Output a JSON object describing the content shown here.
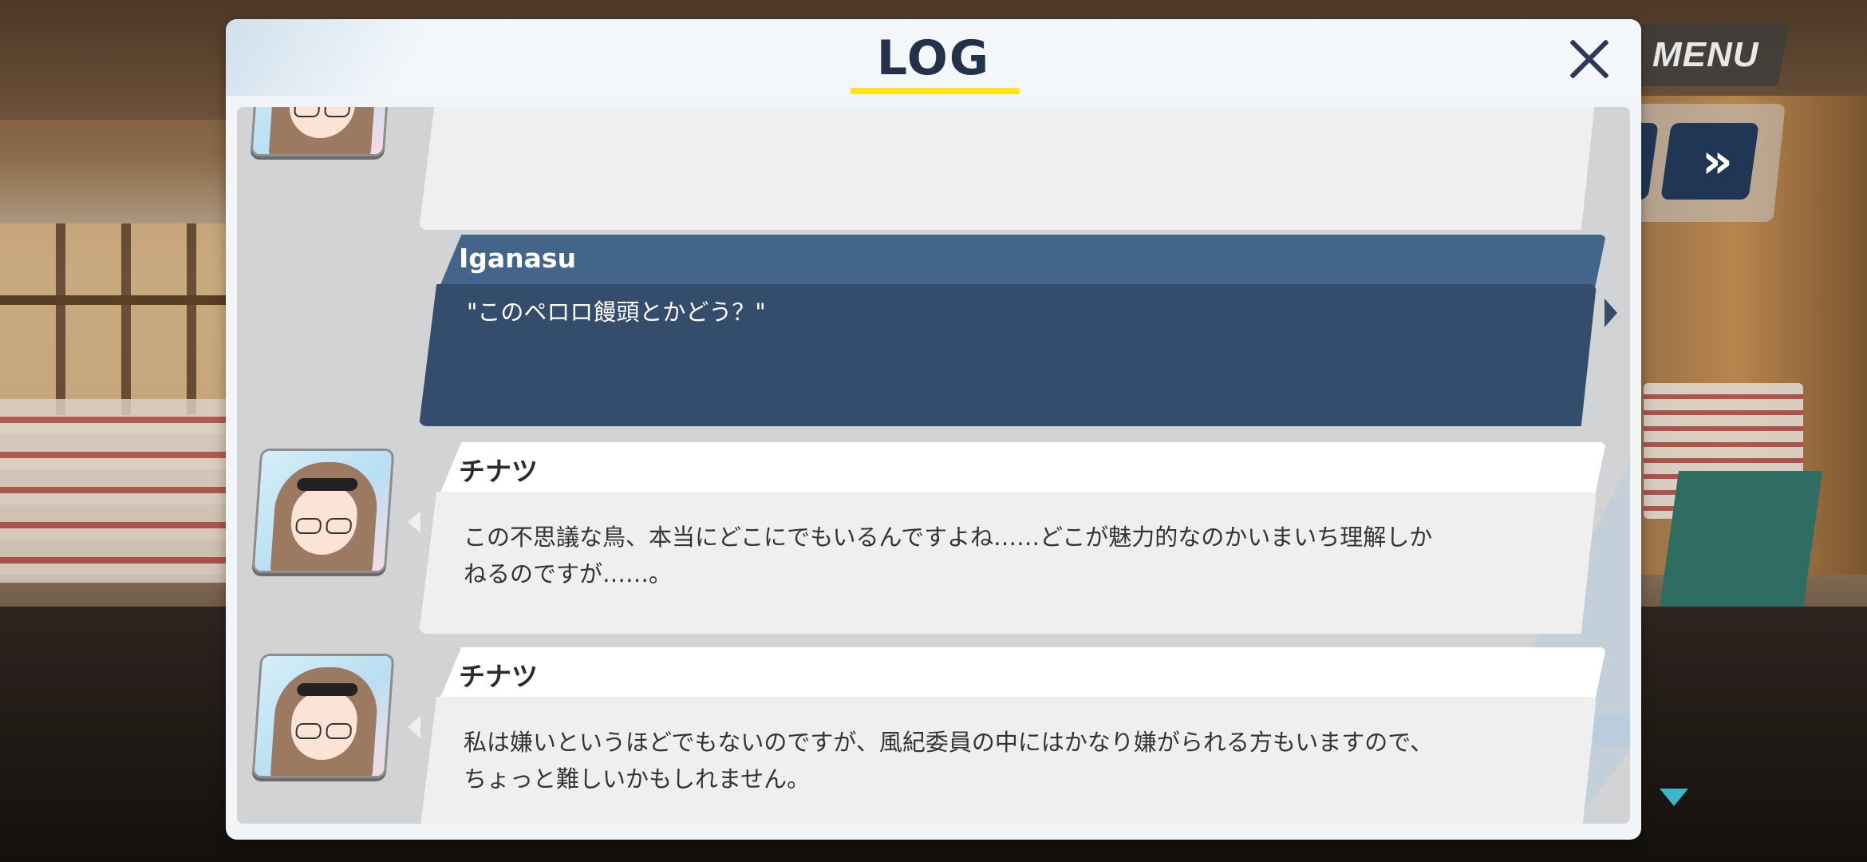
{
  "hud": {
    "menu_label": "MENU",
    "skip_glyph": "»"
  },
  "log": {
    "title": "LOG",
    "entries": [
      {
        "speaker": "",
        "text": "",
        "type": "npc"
      },
      {
        "speaker": "Iganasu",
        "text": "\"このペロロ饅頭とかどう？\"",
        "type": "player"
      },
      {
        "speaker": "チナツ",
        "text": "この不思議な鳥、本当にどこにでもいるんですよね……どこが魅力的なのかいまいち理解しか\nねるのですが……。",
        "type": "npc"
      },
      {
        "speaker": "チナツ",
        "text": "私は嫌いというほどでもないのですが、風紀委員の中にはかなり嫌がられる方もいますので、\nちょっと難しいかもしれません。",
        "type": "npc"
      }
    ]
  },
  "colors": {
    "accent_underline": "#ffe41f",
    "player_bubble": "#354d6d",
    "player_name_bar": "#44658a",
    "title_text": "#23324a",
    "scroll_indicator": "#3cb6c8"
  },
  "icons": [
    "close-icon",
    "skip-icon",
    "auto-icon",
    "scroll-down-icon",
    "character-portrait"
  ]
}
